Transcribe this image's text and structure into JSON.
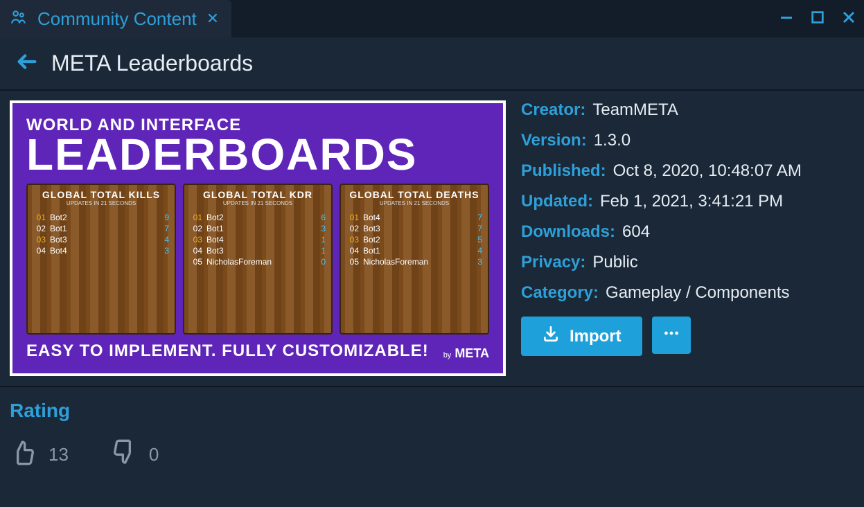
{
  "tab": {
    "label": "Community Content"
  },
  "header": {
    "title": "META Leaderboards"
  },
  "preview": {
    "line1": "WORLD AND INTERFACE",
    "line2": "LEADERBOARDS",
    "tagline": "EASY TO IMPLEMENT. FULLY CUSTOMIZABLE!",
    "brand": "META",
    "brand_prefix": "by",
    "boards": [
      {
        "title": "GLOBAL TOTAL KILLS",
        "sub": "UPDATES IN 21 SECONDS",
        "rows": [
          {
            "rank": "01",
            "name": "Bot2",
            "val": "9",
            "gold": true
          },
          {
            "rank": "02",
            "name": "Bot1",
            "val": "7"
          },
          {
            "rank": "03",
            "name": "Bot3",
            "val": "4",
            "gold": true
          },
          {
            "rank": "04",
            "name": "Bot4",
            "val": "3"
          }
        ]
      },
      {
        "title": "GLOBAL TOTAL KDR",
        "sub": "UPDATES IN 21 SECONDS",
        "rows": [
          {
            "rank": "01",
            "name": "Bot2",
            "val": "6",
            "gold": true
          },
          {
            "rank": "02",
            "name": "Bot1",
            "val": "3"
          },
          {
            "rank": "03",
            "name": "Bot4",
            "val": "1",
            "gold": true
          },
          {
            "rank": "04",
            "name": "Bot3",
            "val": "1"
          },
          {
            "rank": "05",
            "name": "NicholasForeman",
            "val": "0"
          }
        ]
      },
      {
        "title": "GLOBAL TOTAL DEATHS",
        "sub": "UPDATES IN 21 SECONDS",
        "rows": [
          {
            "rank": "01",
            "name": "Bot4",
            "val": "7",
            "gold": true
          },
          {
            "rank": "02",
            "name": "Bot3",
            "val": "7"
          },
          {
            "rank": "03",
            "name": "Bot2",
            "val": "5",
            "gold": true
          },
          {
            "rank": "04",
            "name": "Bot1",
            "val": "4"
          },
          {
            "rank": "05",
            "name": "NicholasForeman",
            "val": "3"
          }
        ]
      }
    ]
  },
  "info": {
    "creator_k": "Creator:",
    "creator_v": "TeamMETA",
    "version_k": "Version:",
    "version_v": "1.3.0",
    "published_k": "Published:",
    "published_v": "Oct 8, 2020, 10:48:07 AM",
    "updated_k": "Updated:",
    "updated_v": "Feb 1, 2021, 3:41:21 PM",
    "downloads_k": "Downloads:",
    "downloads_v": "604",
    "privacy_k": "Privacy:",
    "privacy_v": "Public",
    "category_k": "Category:",
    "category_v": "Gameplay / Components",
    "import_label": "Import"
  },
  "rating": {
    "title": "Rating",
    "up": "13",
    "down": "0"
  }
}
